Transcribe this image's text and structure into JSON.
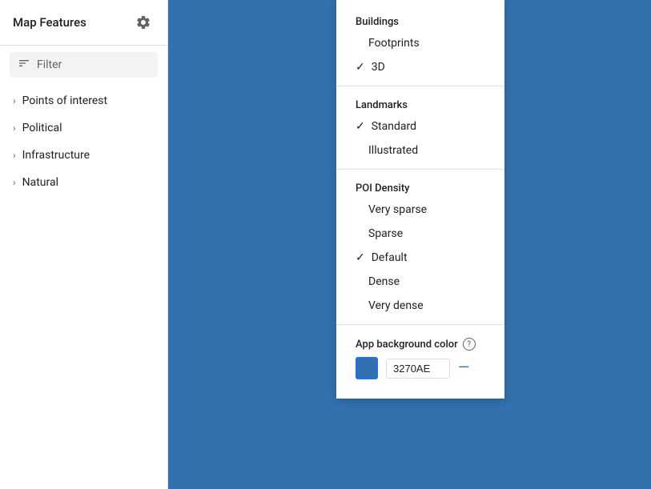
{
  "sidebar": {
    "title": "Map Features",
    "filter_placeholder": "Filter",
    "nav_items": [
      {
        "label": "Points of interest"
      },
      {
        "label": "Political"
      },
      {
        "label": "Infrastructure"
      },
      {
        "label": "Natural"
      }
    ]
  },
  "dropdown": {
    "sections": [
      {
        "label": "Buildings",
        "items": [
          {
            "label": "Footprints",
            "checked": false
          },
          {
            "label": "3D",
            "checked": true
          }
        ]
      },
      {
        "label": "Landmarks",
        "items": [
          {
            "label": "Standard",
            "checked": true
          },
          {
            "label": "Illustrated",
            "checked": false
          }
        ]
      },
      {
        "label": "POI Density",
        "items": [
          {
            "label": "Very sparse",
            "checked": false
          },
          {
            "label": "Sparse",
            "checked": false
          },
          {
            "label": "Default",
            "checked": true
          },
          {
            "label": "Dense",
            "checked": false
          },
          {
            "label": "Very dense",
            "checked": false
          }
        ]
      }
    ],
    "app_bg": {
      "label": "App background color",
      "color_value": "3270AE"
    }
  },
  "icons": {
    "gear": "⚙",
    "filter": "≡",
    "check": "✓",
    "chevron": "›",
    "question": "?",
    "minus": "—"
  }
}
